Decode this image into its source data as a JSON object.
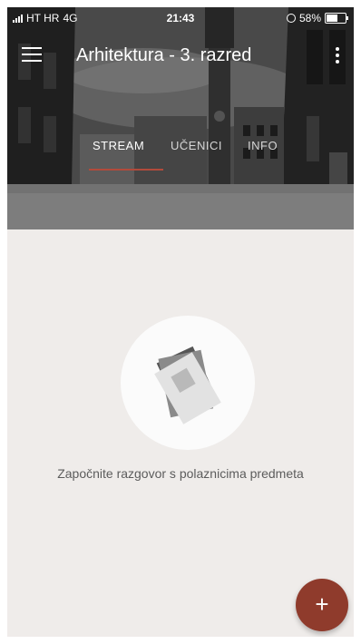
{
  "status_bar": {
    "carrier": "HT HR",
    "network": "4G",
    "time": "21:43",
    "battery_percent": "58%",
    "battery_level": 0.58
  },
  "app_bar": {
    "title": "Arhitektura - 3. razred",
    "menu_icon": "hamburger-menu-icon",
    "more_icon": "more-vertical-icon"
  },
  "tabs": [
    {
      "label": "STREAM",
      "active": true
    },
    {
      "label": "UČENICI",
      "active": false
    },
    {
      "label": "INFO",
      "active": false
    }
  ],
  "accent_color": "#b24a3b",
  "empty_state": {
    "icon": "documents-stack-icon",
    "message": "Započnite razgovor s polaznicima predmeta"
  },
  "fab": {
    "label": "+",
    "color": "#8f3b2c"
  }
}
